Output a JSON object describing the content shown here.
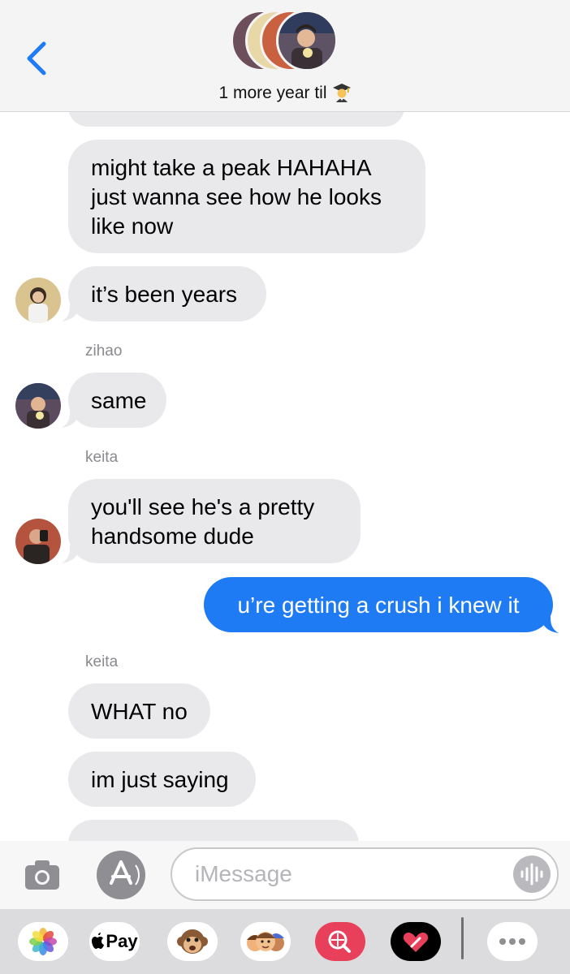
{
  "header": {
    "title": "1 more year til",
    "title_emoji": "graduate-emoji"
  },
  "messages": [
    {
      "id": "m1",
      "direction": "incoming",
      "text": "might take a peak HAHAHA just wanna see how he looks like now"
    },
    {
      "id": "m2",
      "direction": "incoming",
      "text": "it’s been years"
    },
    {
      "id": "m3",
      "direction": "incoming",
      "sender": "zihao",
      "text": "same"
    },
    {
      "id": "m4",
      "direction": "incoming",
      "sender": "keita",
      "text": "you'll see he's a pretty handsome dude"
    },
    {
      "id": "m5",
      "direction": "outgoing",
      "text": "u’re getting a crush i knew it"
    },
    {
      "id": "m6",
      "direction": "incoming",
      "sender": "keita",
      "text": "WHAT no"
    },
    {
      "id": "m7",
      "direction": "incoming",
      "text": "im just saying"
    }
  ],
  "input": {
    "placeholder": "iMessage",
    "value": ""
  },
  "drawer": {
    "apps": [
      "photos-icon",
      "apple-pay-icon",
      "monkey-animoji-icon",
      "memoji-icon",
      "web-search-icon",
      "digital-touch-icon",
      "more-icon"
    ],
    "pay_label": "Pay"
  },
  "colors": {
    "incoming_bubble": "#e9e9eb",
    "outgoing_bubble": "#1f7bf3",
    "accent": "#1f7bf3"
  }
}
